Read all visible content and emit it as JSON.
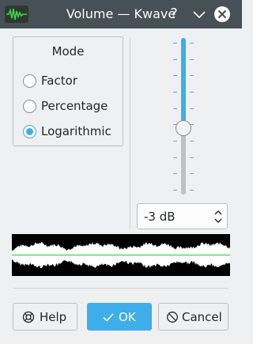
{
  "window": {
    "title": "Volume — Kwave",
    "app_icon": "kwave-waveform-icon",
    "title_buttons": [
      "help-icon",
      "minimize-icon",
      "close-icon"
    ],
    "help_glyph": "?"
  },
  "mode": {
    "title": "Mode",
    "options": [
      {
        "label": "Factor",
        "checked": false
      },
      {
        "label": "Percentage",
        "checked": false
      },
      {
        "label": "Logarithmic",
        "checked": true
      }
    ]
  },
  "slider": {
    "value_fraction": 0.575,
    "ticks": 10
  },
  "spinbox": {
    "value": "-3 dB"
  },
  "waveform": {
    "background": "#000000",
    "wave_color": "#ffffff",
    "centerline_color": "#22cc22"
  },
  "buttons": {
    "help": "Help",
    "ok": "OK",
    "cancel": "Cancel"
  },
  "colors": {
    "accent": "#3daee9",
    "titlebar": "#475057",
    "window": "#eff0f1"
  }
}
